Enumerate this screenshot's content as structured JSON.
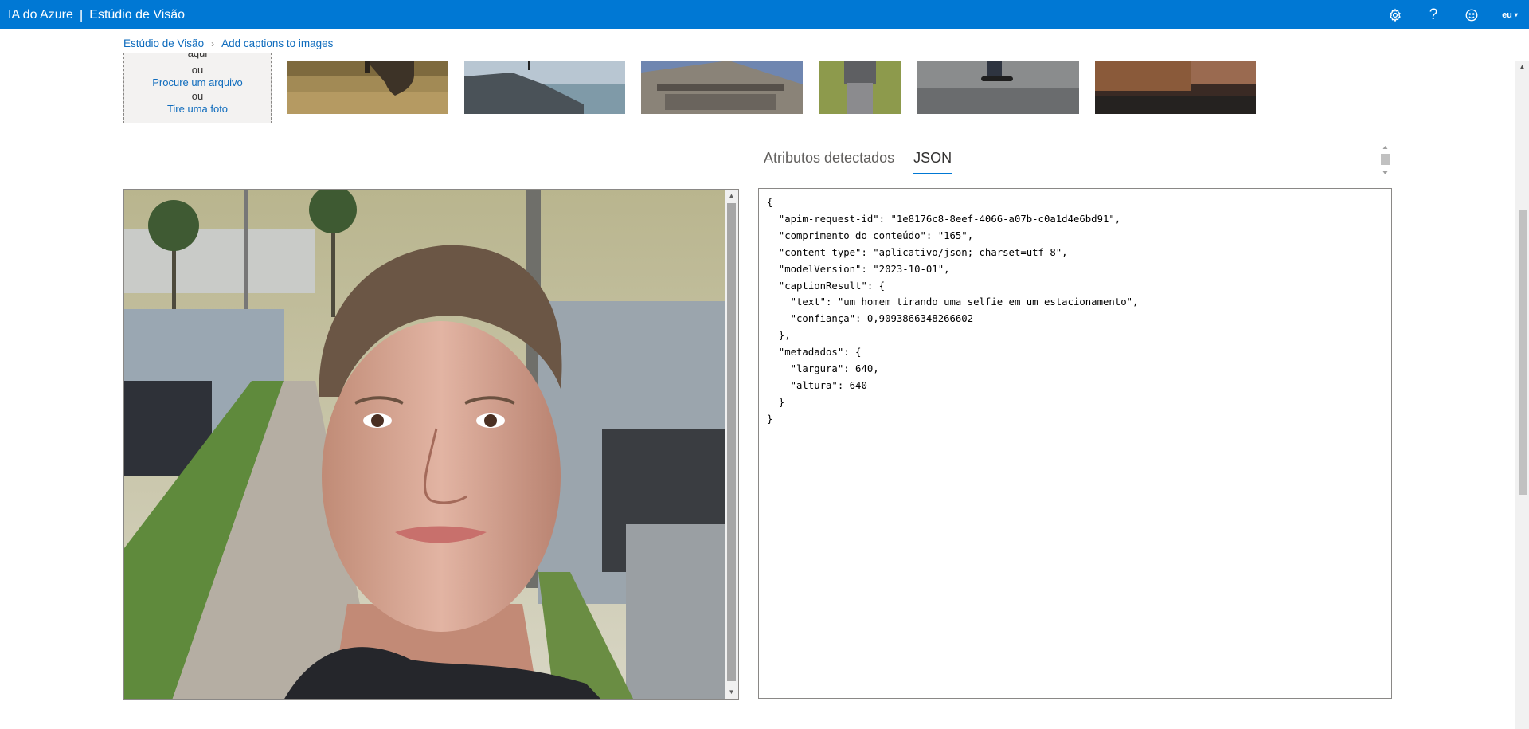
{
  "app": {
    "title": "IA do Azure",
    "separator": "|",
    "subtitle": "Estúdio de Visão",
    "language": "eu"
  },
  "header_icons": [
    "gear-icon",
    "help-icon",
    "smiley-icon",
    "language-selector"
  ],
  "breadcrumb": {
    "home": "Estúdio de Visão",
    "current": "Add captions to images"
  },
  "upload": {
    "top_fragment": "aqui",
    "or_1": "ou",
    "browse": "Procure um arquivo",
    "or_2": "ou",
    "photo": "Tire uma foto"
  },
  "tabs": [
    {
      "label": "Atributos detectados",
      "active": false
    },
    {
      "label": "JSON",
      "active": true
    }
  ],
  "json_result": {
    "request_id": "1e8176c8-8eef-4066-a07b-c0a1d4e6bd91",
    "content_length": "165",
    "content_type": "aplicativo/json; charset=utf-8",
    "model_version": "2023-10-01",
    "caption_text": "um homem tirando uma selfie em um estacionamento",
    "confidence": "0,9093866348266602",
    "width": "640",
    "height": "640",
    "json_lines": [
      "{",
      "  \"apim-request-id\": \"1e8176c8-8eef-4066-a07b-c0a1d4e6bd91\",",
      "  \"comprimento do conteúdo\": \"165\",",
      "  \"content-type\": \"aplicativo/json; charset=utf-8\",",
      "  \"modelVersion\": \"2023-10-01\",",
      "  \"captionResult\": {",
      "    \"text\": \"um homem tirando uma selfie em um estacionamento\",",
      "    \"confiança\": 0,9093866348266602",
      "  },",
      "  \"metadados\": {",
      "    \"largura\": 640,",
      "    \"altura\": 640",
      "  }",
      "}"
    ]
  },
  "colors": {
    "accent": "#0078d4",
    "link": "#0f6cbd"
  }
}
